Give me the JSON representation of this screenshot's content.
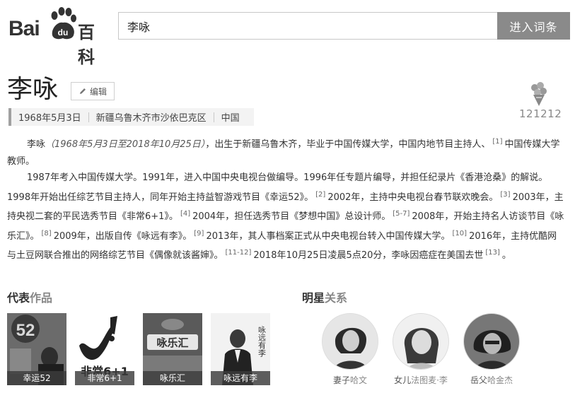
{
  "header": {
    "logo_bai": "Bai",
    "logo_du": "du",
    "logo_baike": "百科",
    "search_value": "李咏",
    "search_button": "进入词条"
  },
  "entry": {
    "title": "李咏",
    "edit_label": "编辑",
    "info": [
      "1968年5月3日",
      "新疆乌鲁木齐市沙依巴克区",
      "中国"
    ],
    "flower_count": "121212"
  },
  "paragraphs": {
    "p1": {
      "a": "李咏",
      "b": "（1968年5月3日至2018年10月25日）",
      "c": "，出生于新疆乌鲁木齐，毕业于中国传媒大学，中国内地节目主持人、",
      "r1": "[1]",
      "d": "中国传媒大学教师。"
    },
    "p2": {
      "s1": "1987年考入中国传媒大学。1991年，进入中国中央电视台做编导。1996年任专题片编导，并担任纪录片《香港沧桑》的解说。1998年开始出任综艺节目主持人，同年开始主持益智游戏节目《幸运52》。",
      "r2": "[2]",
      "s2": "2002年，主持中央电视台春节联欢晚会。",
      "r3": "[3]",
      "s3": "2003年，主持央视二套的平民选秀节目《非常6+1》。",
      "r4": "[4]",
      "s4": "2004年，担任选秀节目《梦想中国》总设计师。",
      "r5": "[5-7]",
      "s5": "2008年，开始主持名人访谈节目《咏乐汇》。",
      "r6": "[8]",
      "s6": "2009年，出版自传《咏远有李》。",
      "r7": "[9]",
      "s7": "2013年，其人事档案正式从中央电视台转入中国传媒大学。",
      "r8": "[10]",
      "s8": "2016年，主持优酷网与土豆网联合推出的网络综艺节目《偶像就该酱婶》。",
      "r9": "[11-12]",
      "s9": "2018年10月25日凌晨5点20分，李咏因癌症在美国去世",
      "r10": "[13]",
      "s10": "。"
    }
  },
  "works": {
    "title_a": "代表",
    "title_b": "作品",
    "items": [
      {
        "label": "幸运52",
        "cover_text": "52"
      },
      {
        "label": "非常6+1",
        "cover_text": "非常6+1"
      },
      {
        "label": "咏乐汇",
        "cover_text": "咏乐汇"
      },
      {
        "label": "咏远有李",
        "cover_text": "咏远有李"
      }
    ]
  },
  "relations": {
    "title_a": "明星",
    "title_b": "关系",
    "items": [
      {
        "role": "妻子",
        "name": "哈文"
      },
      {
        "role": "女儿",
        "name": "法图麦·李"
      },
      {
        "role": "岳父",
        "name": "哈金杰"
      }
    ]
  }
}
